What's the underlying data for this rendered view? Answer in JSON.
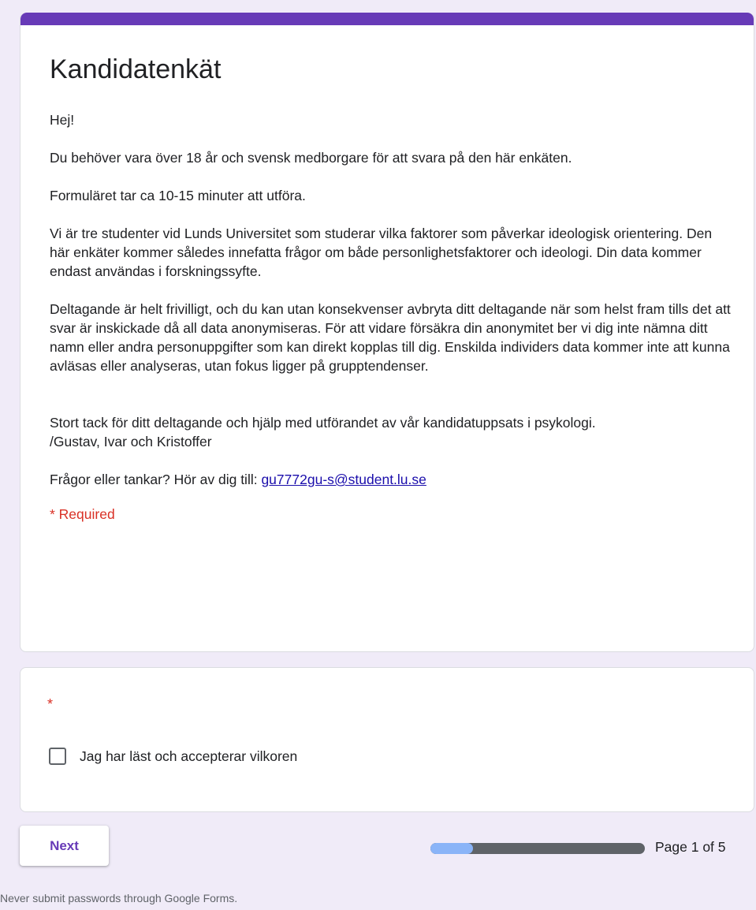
{
  "form": {
    "accent_color": "#673ab7",
    "background_color": "#f0ebf8",
    "title": "Kandidatenkät",
    "description": {
      "greeting": "Hej!",
      "p1": "Du behöver vara över 18 år och svensk medborgare för att svara på den här enkäten.",
      "p2": "Formuläret tar ca 10-15 minuter att utföra.",
      "p3": "Vi är tre studenter vid Lunds Universitet som studerar vilka faktorer som påverkar ideologisk orientering. Den här enkäter kommer således innefatta frågor om både personlighetsfaktorer och ideologi. Din data kommer endast användas i forskningssyfte.",
      "p4": "Deltagande är helt frivilligt, och du kan utan konsekvenser avbryta ditt deltagande när som helst fram tills det att svar är inskickade då all data anonymiseras. För att vidare försäkra din anonymitet ber vi dig inte nämna ditt namn eller andra personuppgifter som kan direkt kopplas till dig. Enskilda individers data kommer inte att kunna avläsas eller analyseras, utan fokus ligger på grupptendenser.",
      "thanks_line1": "Stort tack för ditt deltagande och hjälp med utförandet av vår kandidatuppsats i psykologi.",
      "thanks_line2": "/Gustav, Ivar och Kristoffer",
      "contact_prefix": "Frågor eller tankar? Hör av dig till: ",
      "contact_email": "gu7772gu-s@student.lu.se"
    },
    "required_note": "* Required"
  },
  "question": {
    "required_marker": "*",
    "checkbox_label": "Jag har läst och accepterar vilkoren",
    "checked": false
  },
  "navigation": {
    "next_label": "Next",
    "progress_fraction": 0.2,
    "page_indicator": "Page 1 of 5"
  },
  "footer": {
    "note": "Never submit passwords through Google Forms."
  }
}
